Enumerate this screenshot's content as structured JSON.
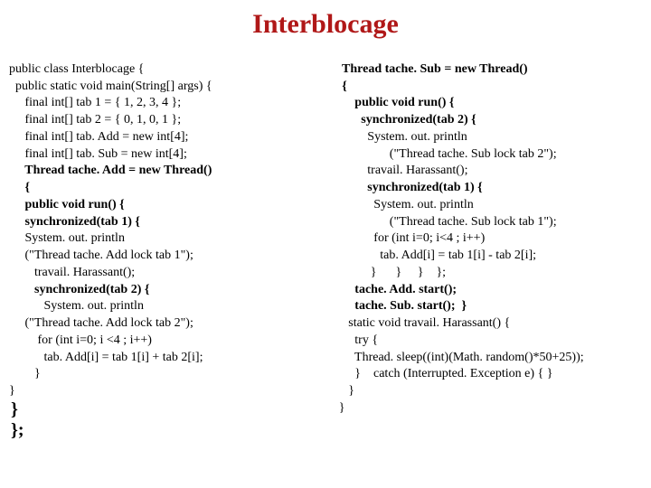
{
  "title": "Interblocage",
  "left": {
    "l01": "public class Interblocage {",
    "l02": "  public static void main(String[] args) {",
    "l03": "     final int[] tab 1 = { 1, 2, 3, 4 };",
    "l04": "     final int[] tab 2 = { 0, 1, 0, 1 };",
    "l05": "     final int[] tab. Add = new int[4];",
    "l06": "     final int[] tab. Sub = new int[4];",
    "l07": "     Thread tache. Add = new Thread()",
    "l08": "     {",
    "l09": "     public void run() {",
    "l10": "     synchronized(tab 1) {",
    "l11": "     System. out. println",
    "l12": "     (\"Thread tache. Add lock tab 1\");",
    "l13": "        travail. Harassant();",
    "l14": "        synchronized(tab 2) {",
    "l15": "           System. out. println",
    "l16": "     (\"Thread tache. Add lock tab 2\");",
    "l17": "         for (int i=0; i <4 ; i++)",
    "l18": "           tab. Add[i] = tab 1[i] + tab 2[i];",
    "l19": "        }",
    "l20": "}",
    "l21": "}",
    "l22": "};"
  },
  "right": {
    "r01": " Thread tache. Sub = new Thread()",
    "r02": " {",
    "r03": "     public void run() {",
    "r04": "       synchronized(tab 2) {",
    "r05": "         System. out. println",
    "r06": "                (\"Thread tache. Sub lock tab 2\");",
    "r07": "         travail. Harassant();",
    "r08": "         synchronized(tab 1) {",
    "r09": "           System. out. println",
    "r10": "                (\"Thread tache. Sub lock tab 1\");",
    "r11": "           for (int i=0; i<4 ; i++)",
    "r12": "             tab. Add[i] = tab 1[i] - tab 2[i];",
    "r13": "          }      }     }    };",
    "r14": "     tache. Add. start();",
    "r15": "     tache. Sub. start();  }",
    "r16": "   static void travail. Harassant() {",
    "r17": "     try {",
    "r18": "     Thread. sleep((int)(Math. random()*50+25));",
    "r19": "     }    catch (Interrupted. Exception e) { }",
    "r20": "   }",
    "r21": "}"
  }
}
